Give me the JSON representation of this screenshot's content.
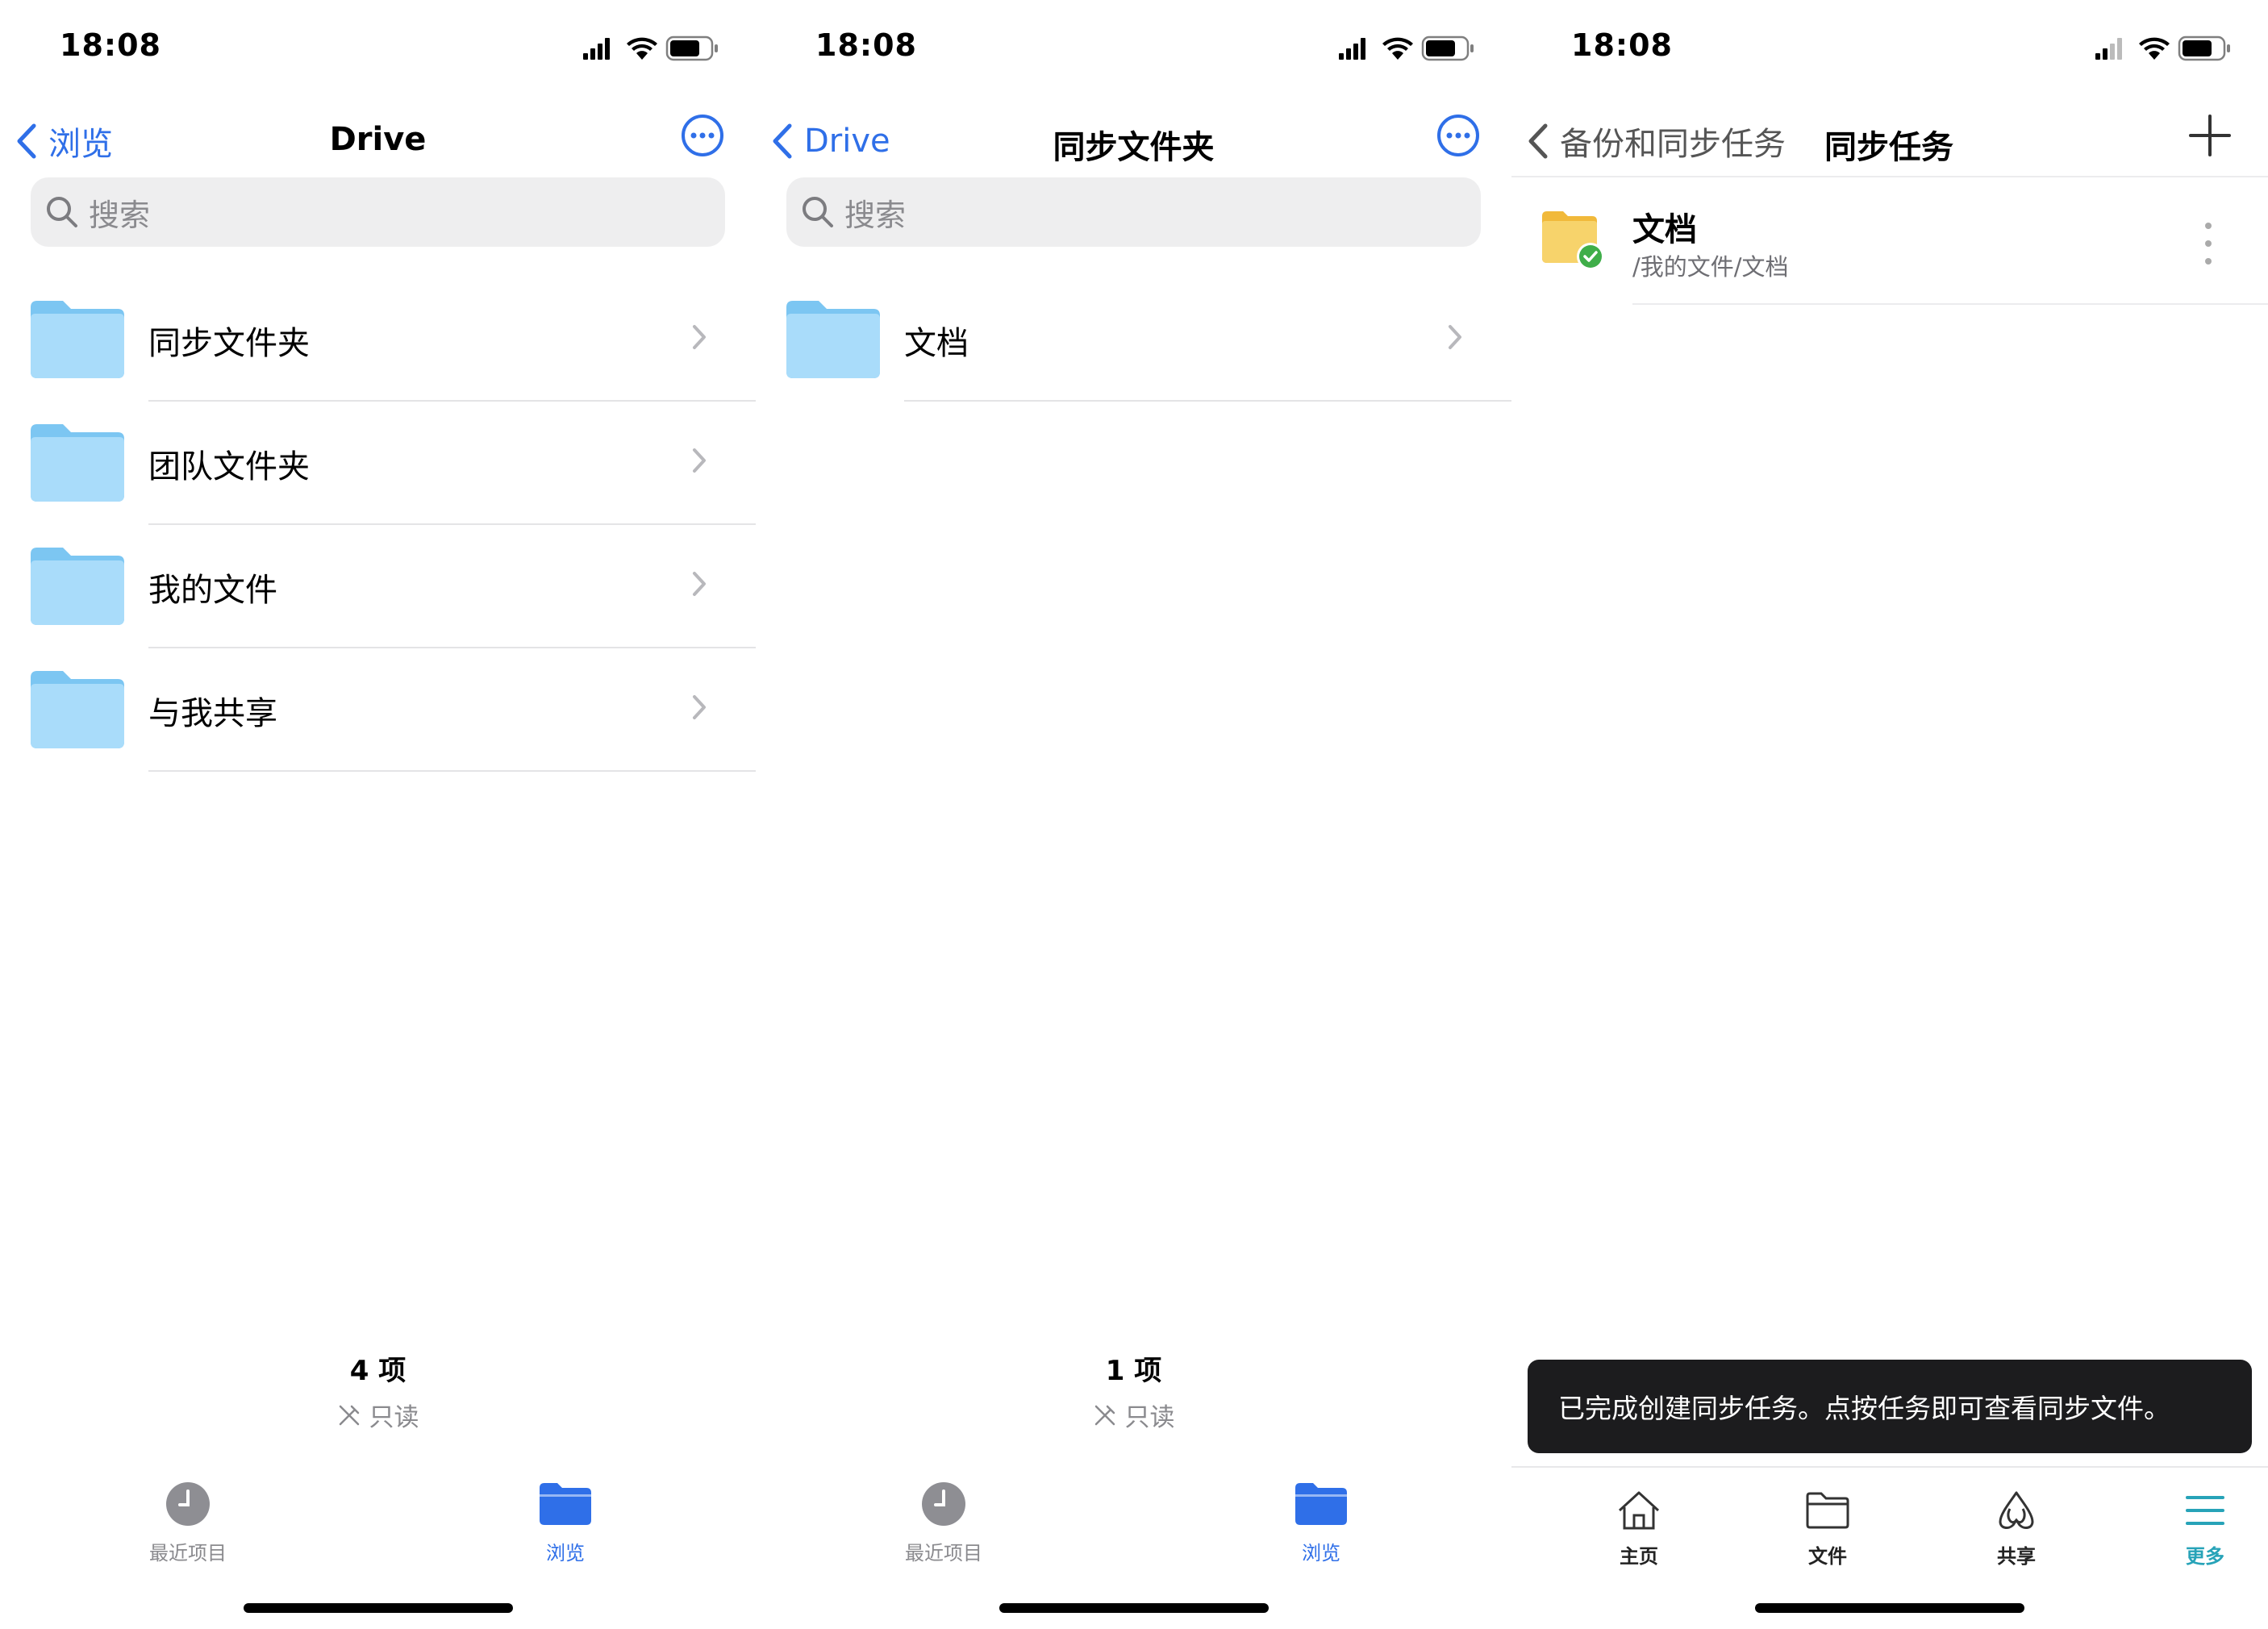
{
  "status": {
    "time": "18:08"
  },
  "panel1": {
    "back_label": "浏览",
    "title": "Drive",
    "search_placeholder": "搜索",
    "items": [
      {
        "label": "同步文件夹"
      },
      {
        "label": "团队文件夹"
      },
      {
        "label": "我的文件"
      },
      {
        "label": "与我共享"
      }
    ],
    "count": "4 项",
    "readonly": "只读",
    "tabs": {
      "recent": "最近项目",
      "browse": "浏览"
    }
  },
  "panel2": {
    "back_label": "Drive",
    "title": "同步文件夹",
    "search_placeholder": "搜索",
    "items": [
      {
        "label": "文档"
      }
    ],
    "count": "1 项",
    "readonly": "只读",
    "tabs": {
      "recent": "最近项目",
      "browse": "浏览"
    }
  },
  "panel3": {
    "back_label": "备份和同步任务",
    "title": "同步任务",
    "task": {
      "name": "文档",
      "path": "/我的文件/文档"
    },
    "toast": "已完成创建同步任务。点按任务即可查看同步文件。",
    "tabs": {
      "home": "主页",
      "files": "文件",
      "share": "共享",
      "more": "更多"
    }
  },
  "colors": {
    "accent_blue": "#2f6fe8",
    "folder_blue": "#8fd0f6",
    "folder_yellow": "#f4c542",
    "check_green": "#3fae49",
    "teal_active": "#27a3b8"
  }
}
